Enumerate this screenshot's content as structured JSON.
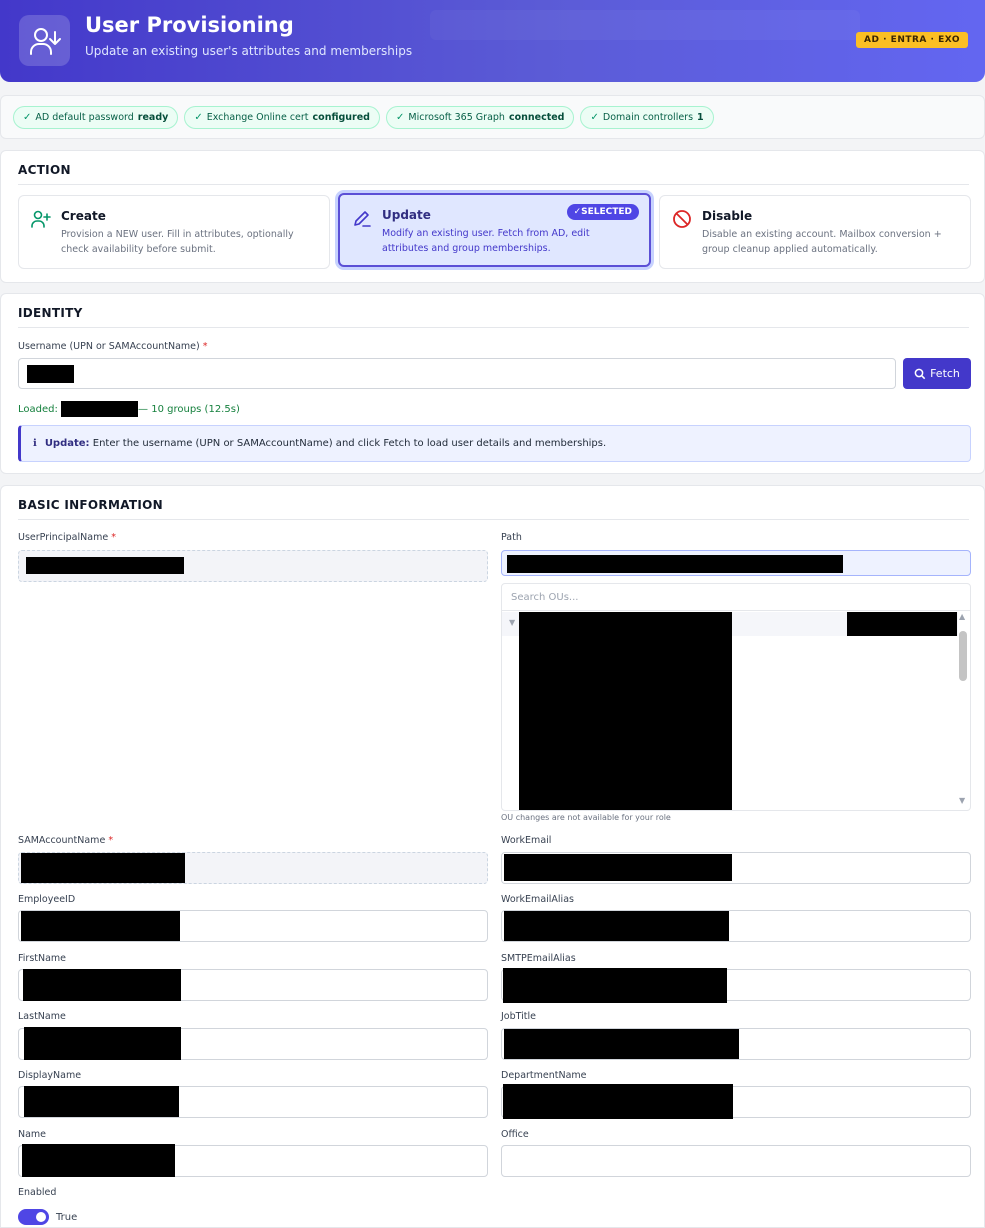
{
  "header": {
    "title": "User Provisioning",
    "subtitle": "Update an existing user's attributes and memberships",
    "badge": "AD · ENTRA · EXO"
  },
  "status": [
    {
      "label": "AD default password",
      "value": "ready"
    },
    {
      "label": "Exchange Online cert",
      "value": "configured"
    },
    {
      "label": "Microsoft 365 Graph",
      "value": "connected"
    },
    {
      "label": "Domain controllers",
      "value": "1"
    }
  ],
  "action": {
    "heading": "ACTION",
    "selected_badge": "✓SELECTED",
    "cards": [
      {
        "title": "Create",
        "desc": "Provision a NEW user. Fill in attributes, optionally check availability before submit."
      },
      {
        "title": "Update",
        "desc": "Modify an existing user. Fetch from AD, edit attributes and group memberships."
      },
      {
        "title": "Disable",
        "desc": "Disable an existing account. Mailbox conversion + group cleanup applied automatically."
      }
    ]
  },
  "identity": {
    "heading": "IDENTITY",
    "username_label": "Username (UPN or SAMAccountName)",
    "required_mark": "*",
    "fetch_label": "Fetch",
    "loaded_prefix": "Loaded:",
    "loaded_suffix": "— 10 groups (12.5s)",
    "info_title": "Update:",
    "info_text": "Enter the username (UPN or SAMAccountName) and click Fetch to load user details and memberships."
  },
  "basic": {
    "heading": "BASIC INFORMATION",
    "upn_label": "UserPrincipalName",
    "path_label": "Path",
    "ou_search_placeholder": "Search OUs...",
    "ou_note": "OU changes are not available for your role",
    "sam_label": "SAMAccountName",
    "employeeid_label": "EmployeeID",
    "firstname_label": "FirstName",
    "lastname_label": "LastName",
    "displayname_label": "DisplayName",
    "name_label": "Name",
    "workemail_label": "WorkEmail",
    "workemailalias_label": "WorkEmailAlias",
    "smtpemailalias_label": "SMTPEmailAlias",
    "jobtitle_label": "JobTitle",
    "department_label": "DepartmentName",
    "office_label": "Office",
    "enabled_label": "Enabled",
    "enabled_value": "True"
  }
}
